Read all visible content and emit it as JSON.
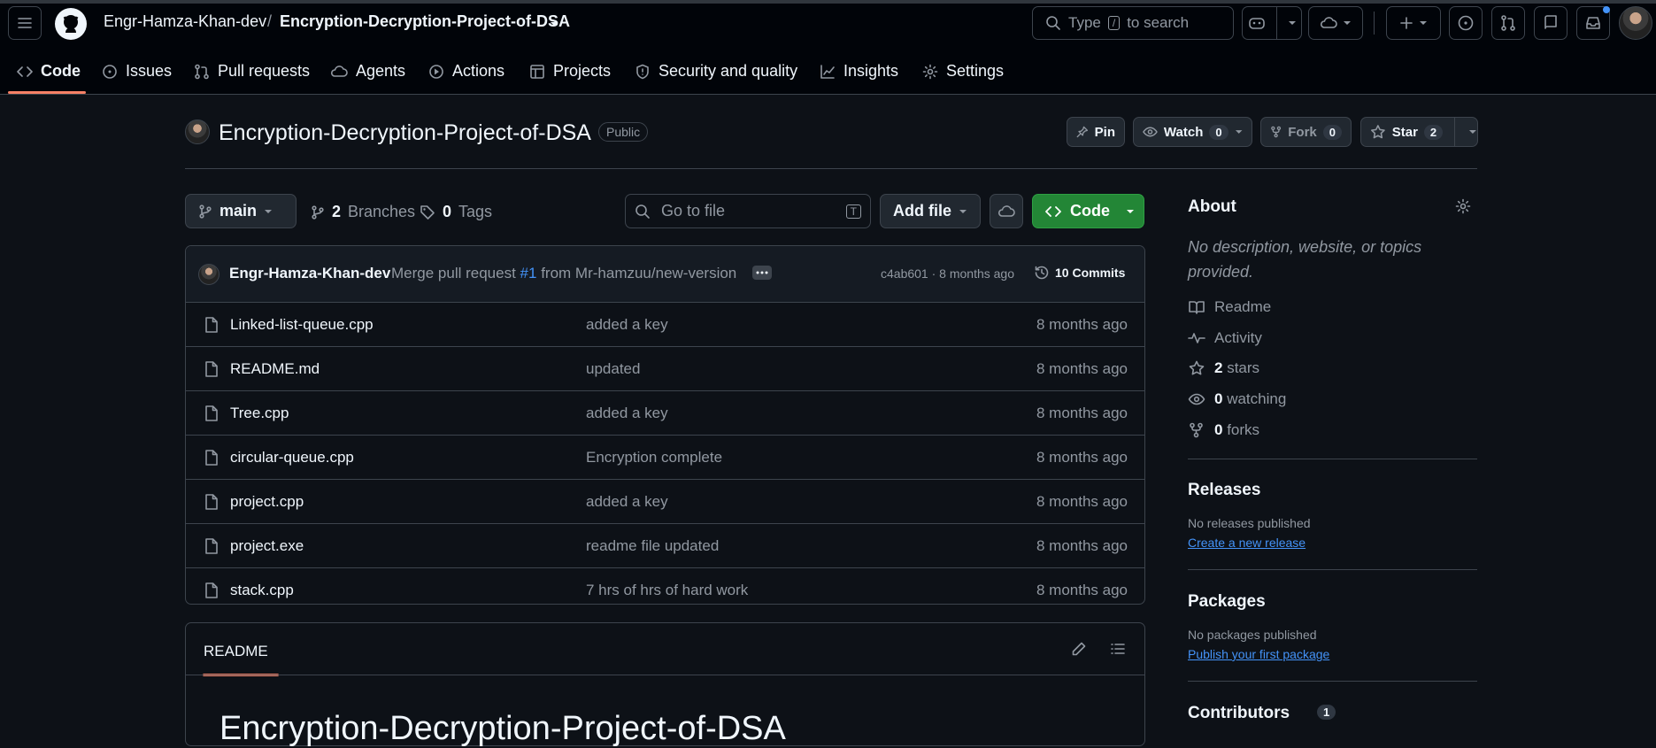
{
  "header": {
    "owner": "Engr-Hamza-Khan-dev",
    "separator": "/",
    "repo": "Encryption-Decryption-Project-of-DSA",
    "search_pre": "Type",
    "search_key": "/",
    "search_post": "to search"
  },
  "nav": [
    {
      "label": "Code",
      "icon": "code-icon"
    },
    {
      "label": "Issues",
      "icon": "issue-icon"
    },
    {
      "label": "Pull requests",
      "icon": "pull-request-icon"
    },
    {
      "label": "Agents",
      "icon": "agent-icon"
    },
    {
      "label": "Actions",
      "icon": "play-icon"
    },
    {
      "label": "Projects",
      "icon": "table-icon"
    },
    {
      "label": "Security and quality",
      "icon": "shield-icon"
    },
    {
      "label": "Insights",
      "icon": "graph-icon"
    },
    {
      "label": "Settings",
      "icon": "gear-icon"
    }
  ],
  "repo_header": {
    "title": "Encryption-Decryption-Project-of-DSA",
    "visibility": "Public",
    "pin": "Pin",
    "watch": "Watch",
    "watch_count": "0",
    "fork": "Fork",
    "fork_count": "0",
    "star": "Star",
    "star_count": "2"
  },
  "toolbar": {
    "branch": "main",
    "branches_count": "2",
    "branches_label": "Branches",
    "tags_count": "0",
    "tags_label": "Tags",
    "goto_placeholder": "Go to file",
    "goto_key": "T",
    "add_file": "Add file",
    "code": "Code"
  },
  "commit": {
    "author": "Engr-Hamza-Khan-dev",
    "message_pre": "Merge pull request",
    "pr": "#1",
    "message_post": "from Mr-hamzuu/new-version",
    "hash_time": "c4ab601 · 8 months ago",
    "commits": "10 Commits"
  },
  "files": [
    {
      "name": "Linked-list-queue.cpp",
      "message": "added a key",
      "time": "8 months ago"
    },
    {
      "name": "README.md",
      "message": "updated",
      "time": "8 months ago"
    },
    {
      "name": "Tree.cpp",
      "message": "added a key",
      "time": "8 months ago"
    },
    {
      "name": "circular-queue.cpp",
      "message": "Encryption complete",
      "time": "8 months ago"
    },
    {
      "name": "project.cpp",
      "message": "added a key",
      "time": "8 months ago"
    },
    {
      "name": "project.exe",
      "message": "readme file updated",
      "time": "8 months ago"
    },
    {
      "name": "stack.cpp",
      "message": "7 hrs of hrs of hard work",
      "time": "8 months ago"
    }
  ],
  "readme": {
    "tab": "README",
    "heading": "Encryption-Decryption-Project-of-DSA"
  },
  "about": {
    "title": "About",
    "description": "No description, website, or topics provided.",
    "readme": "Readme",
    "activity": "Activity",
    "stars_count": "2",
    "stars_label": "stars",
    "watching_count": "0",
    "watching_label": "watching",
    "forks_count": "0",
    "forks_label": "forks"
  },
  "releases": {
    "title": "Releases",
    "none": "No releases published",
    "link": "Create a new release"
  },
  "packages": {
    "title": "Packages",
    "none": "No packages published",
    "link": "Publish your first package"
  },
  "contributors": {
    "title": "Contributors",
    "count": "1"
  },
  "colors": {
    "background": "#0d1117",
    "header": "#010409",
    "border": "#3d444d",
    "accent_green": "#238636",
    "active_tab": "#f78166",
    "link": "#4493f8"
  }
}
